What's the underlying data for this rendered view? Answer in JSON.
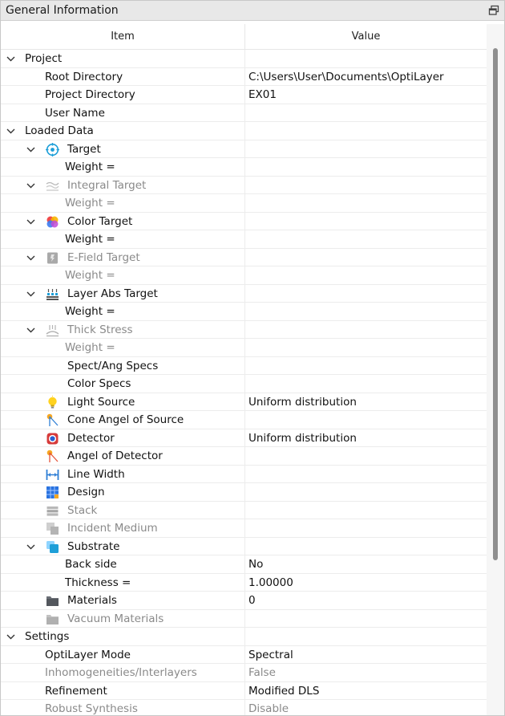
{
  "panel": {
    "title": "General Information",
    "columns": {
      "item": "Item",
      "value": "Value"
    }
  },
  "rows": [
    {
      "label": "Project",
      "value": "",
      "level": 0,
      "expander": "expanded",
      "icon": "",
      "gray": false
    },
    {
      "label": "Root Directory",
      "value": "C:\\Users\\User\\Documents\\OptiLayer",
      "level": 1,
      "expander": "",
      "icon": "",
      "gray": false
    },
    {
      "label": "Project Directory",
      "value": "EX01",
      "level": 1,
      "expander": "",
      "icon": "",
      "gray": false
    },
    {
      "label": "User Name",
      "value": "",
      "level": 1,
      "expander": "",
      "icon": "",
      "gray": false
    },
    {
      "label": "Loaded Data",
      "value": "",
      "level": 0,
      "expander": "expanded",
      "icon": "",
      "gray": false
    },
    {
      "label": "Target",
      "value": "",
      "level": 1,
      "expander": "expanded",
      "icon": "target-icon",
      "gray": false
    },
    {
      "label": "Weight =",
      "value": "",
      "level": 2,
      "expander": "",
      "icon": "",
      "gray": false
    },
    {
      "label": "Integral Target",
      "value": "",
      "level": 1,
      "expander": "expanded",
      "icon": "integral-target-icon",
      "gray": true
    },
    {
      "label": "Weight =",
      "value": "",
      "level": 2,
      "expander": "",
      "icon": "",
      "gray": true
    },
    {
      "label": "Color Target",
      "value": "",
      "level": 1,
      "expander": "expanded",
      "icon": "color-target-icon",
      "gray": false
    },
    {
      "label": "Weight =",
      "value": "",
      "level": 2,
      "expander": "",
      "icon": "",
      "gray": false
    },
    {
      "label": "E-Field Target",
      "value": "",
      "level": 1,
      "expander": "expanded",
      "icon": "efield-target-icon",
      "gray": true
    },
    {
      "label": "Weight =",
      "value": "",
      "level": 2,
      "expander": "",
      "icon": "",
      "gray": true
    },
    {
      "label": "Layer Abs Target",
      "value": "",
      "level": 1,
      "expander": "expanded",
      "icon": "layer-abs-target-icon",
      "gray": false
    },
    {
      "label": "Weight =",
      "value": "",
      "level": 2,
      "expander": "",
      "icon": "",
      "gray": false
    },
    {
      "label": "Thick Stress",
      "value": "",
      "level": 1,
      "expander": "expanded",
      "icon": "thick-stress-icon",
      "gray": true
    },
    {
      "label": "Weight =",
      "value": "",
      "level": 2,
      "expander": "",
      "icon": "",
      "gray": true
    },
    {
      "label": "Spect/Ang Specs",
      "value": "",
      "level": 1,
      "expander": "",
      "icon": "",
      "gray": false
    },
    {
      "label": "Color Specs",
      "value": "",
      "level": 1,
      "expander": "",
      "icon": "",
      "gray": false
    },
    {
      "label": "Light Source",
      "value": "Uniform distribution",
      "level": 1,
      "expander": "",
      "icon": "light-bulb-icon",
      "gray": false
    },
    {
      "label": "Cone Angel of Source",
      "value": "",
      "level": 1,
      "expander": "",
      "icon": "cone-angle-icon",
      "gray": false
    },
    {
      "label": "Detector",
      "value": "Uniform distribution",
      "level": 1,
      "expander": "",
      "icon": "detector-icon",
      "gray": false
    },
    {
      "label": "Angel of Detector",
      "value": "",
      "level": 1,
      "expander": "",
      "icon": "detector-angle-icon",
      "gray": false
    },
    {
      "label": "Line Width",
      "value": "",
      "level": 1,
      "expander": "",
      "icon": "line-width-icon",
      "gray": false
    },
    {
      "label": "Design",
      "value": "",
      "level": 1,
      "expander": "",
      "icon": "design-grid-icon",
      "gray": false
    },
    {
      "label": "Stack",
      "value": "",
      "level": 1,
      "expander": "",
      "icon": "stack-icon",
      "gray": true
    },
    {
      "label": "Incident Medium",
      "value": "",
      "level": 1,
      "expander": "",
      "icon": "incident-medium-icon",
      "gray": true
    },
    {
      "label": "Substrate",
      "value": "",
      "level": 1,
      "expander": "expanded",
      "icon": "substrate-icon",
      "gray": false
    },
    {
      "label": "Back side",
      "value": "No",
      "level": 2,
      "expander": "",
      "icon": "",
      "gray": false
    },
    {
      "label": "Thickness =",
      "value": "1.00000",
      "level": 2,
      "expander": "",
      "icon": "",
      "gray": false
    },
    {
      "label": "Materials",
      "value": "0",
      "level": 1,
      "expander": "",
      "icon": "folder-icon",
      "gray": false
    },
    {
      "label": "Vacuum Materials",
      "value": "",
      "level": 1,
      "expander": "",
      "icon": "folder-gray-icon",
      "gray": true
    },
    {
      "label": "Settings",
      "value": "",
      "level": 0,
      "expander": "expanded",
      "icon": "",
      "gray": false
    },
    {
      "label": "OptiLayer Mode",
      "value": "Spectral",
      "level": 1,
      "expander": "",
      "icon": "",
      "gray": false
    },
    {
      "label": "Inhomogeneities/Interlayers",
      "value": "False",
      "level": 1,
      "expander": "",
      "icon": "",
      "gray": true
    },
    {
      "label": "Refinement",
      "value": "Modified DLS",
      "level": 1,
      "expander": "",
      "icon": "",
      "gray": false
    },
    {
      "label": "Robust Synthesis",
      "value": "Disable",
      "level": 1,
      "expander": "",
      "icon": "",
      "gray": true
    }
  ]
}
